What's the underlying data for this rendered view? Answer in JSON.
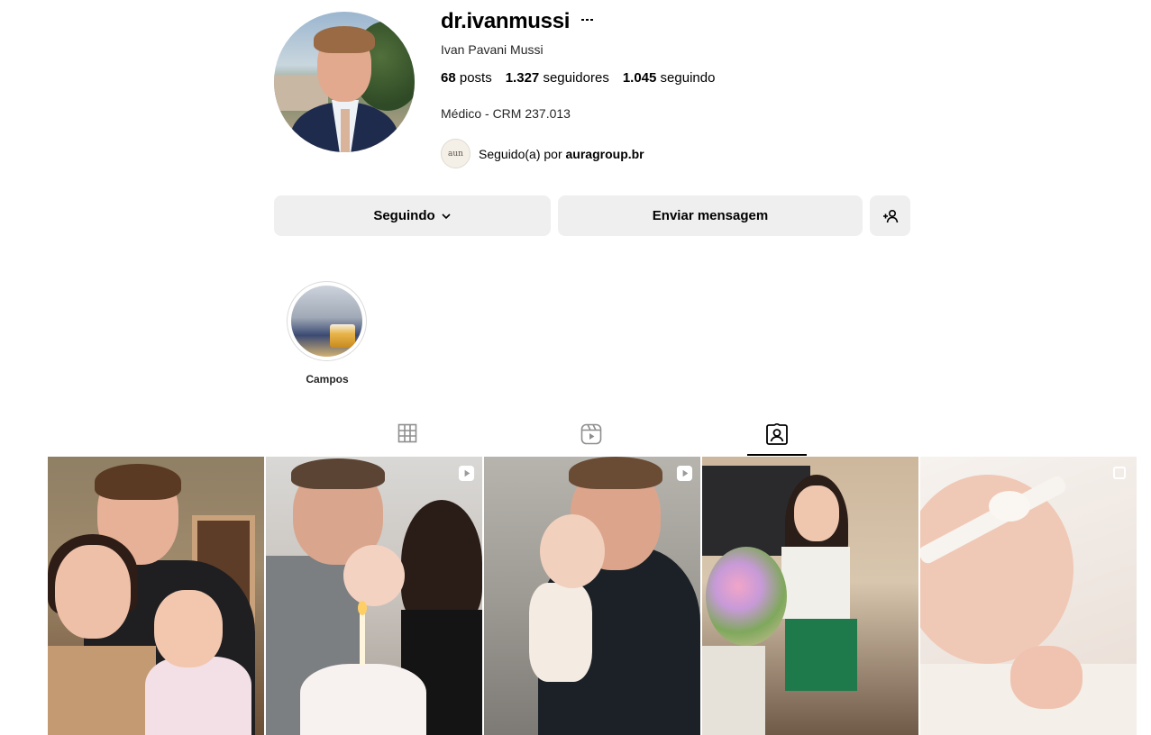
{
  "profile": {
    "username": "dr.ivanmussi",
    "full_name": "Ivan Pavani Mussi",
    "stats": {
      "posts_count": "68",
      "posts_label": "posts",
      "followers_count": "1.327",
      "followers_label": "seguidores",
      "following_count": "1.045",
      "following_label": "seguindo"
    },
    "bio": "Médico - CRM 237.013",
    "followed_by": {
      "avatar_text": "aun",
      "prefix": "Seguido(a) por",
      "account": "auragroup.br"
    }
  },
  "actions": {
    "following_label": "Seguindo",
    "message_label": "Enviar mensagem",
    "suggest_icon": "add-person-icon"
  },
  "highlights": [
    {
      "label": "Campos"
    }
  ],
  "tabs": [
    {
      "icon": "grid-icon",
      "active": false
    },
    {
      "icon": "reels-icon",
      "active": false
    },
    {
      "icon": "tagged-icon",
      "active": true
    }
  ],
  "posts": [
    {
      "type": "photo"
    },
    {
      "type": "reel"
    },
    {
      "type": "reel"
    },
    {
      "type": "photo"
    },
    {
      "type": "carousel"
    }
  ],
  "colors": {
    "button_bg": "#efefef",
    "text_primary": "#000000",
    "text_secondary": "#262626",
    "divider": "#dbdbdb"
  }
}
